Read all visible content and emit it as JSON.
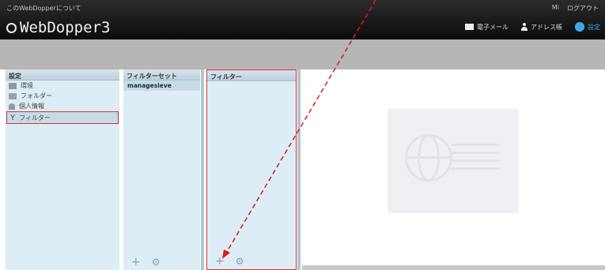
{
  "header": {
    "about": "このWebDopperについて",
    "product": "WebDopper3",
    "top_links": {
      "left": "Mi",
      "logout": "ログアウト"
    },
    "tasks": [
      {
        "label": "電子メール"
      },
      {
        "label": "アドレス帳"
      },
      {
        "label": "設定"
      }
    ]
  },
  "settings_panel": {
    "title": "設定",
    "items": [
      {
        "label": "環境"
      },
      {
        "label": "フォルダー"
      },
      {
        "label": "個人情報"
      },
      {
        "label": "フィルター"
      }
    ]
  },
  "filter_sets_panel": {
    "title": "フィルターセット",
    "items": [
      "managesieve"
    ],
    "add_label": "+",
    "actions_label": "⚙"
  },
  "filters_panel": {
    "title": "フィルター",
    "add_label": "+",
    "actions_label": "⚙"
  },
  "colors": {
    "accent": "#3aa7e6",
    "highlight_border": "#d83232",
    "panel_bg": "#dcedf6"
  }
}
